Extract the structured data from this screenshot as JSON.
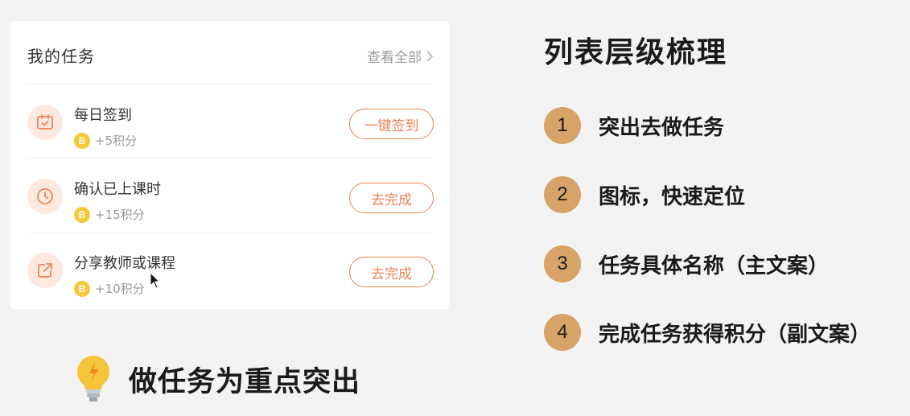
{
  "task_card": {
    "title": "我的任务",
    "view_all": "查看全部",
    "tasks": [
      {
        "name": "每日签到",
        "points": "+5积分",
        "button": "一键签到",
        "icon": "calendar-check-icon"
      },
      {
        "name": "确认已上课时",
        "points": "+15积分",
        "button": "去完成",
        "icon": "clock-icon"
      },
      {
        "name": "分享教师或课程",
        "points": "+10积分",
        "button": "去完成",
        "icon": "share-icon"
      }
    ],
    "coin_letter": "B"
  },
  "tip": {
    "text": "做任务为重点突出",
    "icon": "lightbulb-icon"
  },
  "outline": {
    "title": "列表层级梳理",
    "items": [
      {
        "num": "1",
        "text": "突出去做任务"
      },
      {
        "num": "2",
        "text": "图标，快速定位"
      },
      {
        "num": "3",
        "text": "任务具体名称（主文案）"
      },
      {
        "num": "4",
        "text": "完成任务获得积分（副文案）"
      }
    ]
  },
  "colors": {
    "accent": "#e9835a",
    "icon_bg": "#fde9e0",
    "coin": "#f7c938",
    "number_badge": "#d7a368"
  }
}
